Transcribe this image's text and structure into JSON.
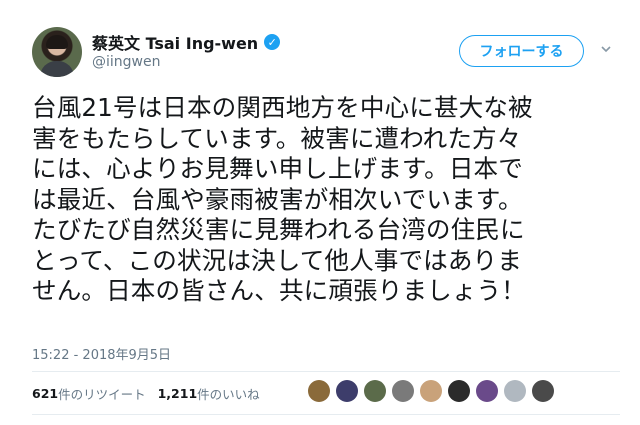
{
  "author": {
    "display_name": "蔡英文 Tsai Ing-wen",
    "handle": "@iingwen",
    "verified_icon": "✓"
  },
  "actions": {
    "follow_label": "フォローする",
    "more_icon": "chevron-down-icon"
  },
  "tweet": {
    "text": "台風21号は日本の関西地方を中心に甚大な被\n害をもたらしています。被害に遭われた方々\nには、心よりお見舞い申し上げます。日本で\nは最近、台風や豪雨被害が相次いでいます。\nたびたび自然災害に見舞われる台湾の住民に\nとって、この状況は決して他人事ではありま\nせん。日本の皆さん、共に頑張りましょう！",
    "timestamp": "15:22 - 2018年9月5日"
  },
  "stats": {
    "retweet_count": "621",
    "retweet_label": "件のリツイート",
    "like_count": "1,211",
    "like_label": " 件のいいね"
  },
  "likers": [
    {
      "name": "liker-avatar-1",
      "color": "#8a6a3a"
    },
    {
      "name": "liker-avatar-2",
      "color": "#3d3d6b"
    },
    {
      "name": "liker-avatar-3",
      "color": "#5b6b4a"
    },
    {
      "name": "liker-avatar-4",
      "color": "#7a7a7a"
    },
    {
      "name": "liker-avatar-5",
      "color": "#c9a27a"
    },
    {
      "name": "liker-avatar-6",
      "color": "#2b2b2b"
    },
    {
      "name": "liker-avatar-7",
      "color": "#6a4a8a"
    },
    {
      "name": "liker-avatar-8",
      "color": "#b0b8c0"
    },
    {
      "name": "liker-avatar-9",
      "color": "#4a4a4a"
    }
  ],
  "colors": {
    "accent": "#1da1f2",
    "secondary_text": "#657786"
  }
}
